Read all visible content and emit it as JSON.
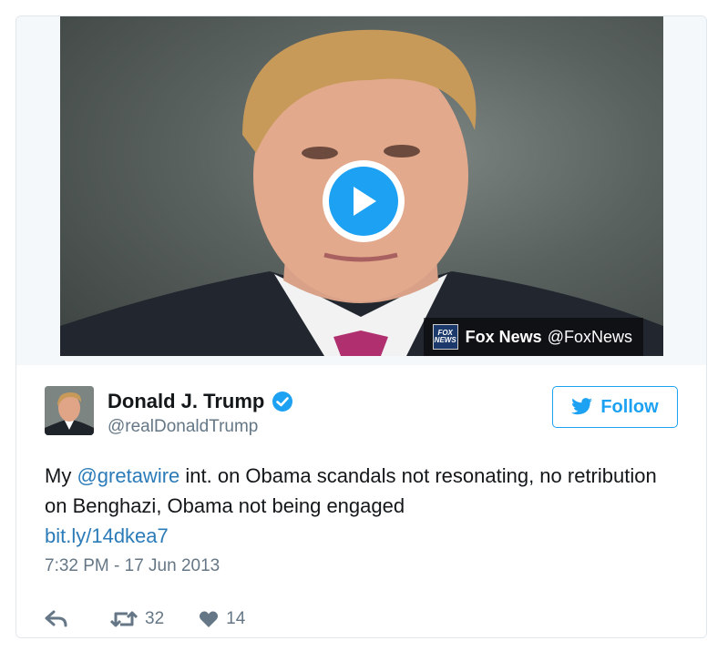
{
  "media": {
    "source_name": "Fox News",
    "source_handle": "@FoxNews",
    "source_logo_text": "FOX NEWS"
  },
  "tweet": {
    "display_name": "Donald J. Trump",
    "screen_name": "@realDonaldTrump",
    "follow_label": "Follow",
    "text_prefix": "My ",
    "mention": "@gretawire",
    "text_body": " int. on Obama scandals not resonating, no retribution on Benghazi, Obama not being engaged",
    "link": "bit.ly/14dkea7",
    "timestamp": "7:32 PM - 17 Jun 2013",
    "retweet_count": "32",
    "like_count": "14"
  },
  "colors": {
    "accent": "#1da1f2",
    "link": "#2b7bb9",
    "secondary_text": "#657786",
    "tie": "#b0306f"
  },
  "icons": [
    "play-icon",
    "fox-news-logo",
    "verified-icon",
    "twitter-bird-icon",
    "reply-icon",
    "retweet-icon",
    "heart-icon"
  ]
}
